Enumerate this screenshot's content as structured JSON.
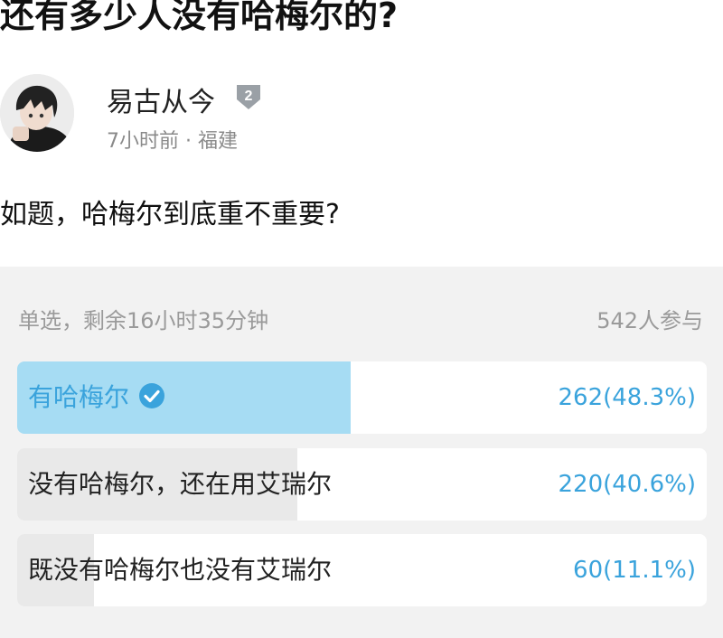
{
  "post": {
    "title": "还有多少人没有哈梅尔的?",
    "author": {
      "name": "易古从今",
      "level_badge": "2"
    },
    "meta": "7小时前 · 福建",
    "body": "如题，哈梅尔到底重不重要?"
  },
  "poll": {
    "info": "单选，剩余16小时35分钟",
    "participants": "542人参与",
    "accent_color": "#3aa3dc",
    "selected_fill_color": "#a6dcf3",
    "unselected_fill_color": "#e9e9e9",
    "options": [
      {
        "label": "有哈梅尔",
        "result": "262(48.3%)",
        "percent": 48.3,
        "selected": true,
        "icon": "check-circle-icon"
      },
      {
        "label": "没有哈梅尔，还在用艾瑞尔",
        "result": "220(40.6%)",
        "percent": 40.6,
        "selected": false
      },
      {
        "label": "既没有哈梅尔也没有艾瑞尔",
        "result": "60(11.1%)",
        "percent": 11.1,
        "selected": false
      }
    ]
  }
}
